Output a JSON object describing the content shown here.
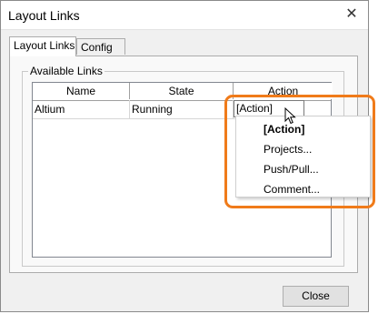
{
  "window": {
    "title": "Layout Links",
    "close_glyph": "✕"
  },
  "tabs": [
    {
      "label": "Layout Links",
      "active": true
    },
    {
      "label": "Config",
      "active": false
    }
  ],
  "group": {
    "legend": "Available Links"
  },
  "table": {
    "columns": [
      "Name",
      "State",
      "Action"
    ],
    "rows": [
      {
        "name": "Altium",
        "state": "Running",
        "action": "[Action]"
      }
    ]
  },
  "context_menu": {
    "items": [
      {
        "label": "[Action]",
        "bold": true
      },
      {
        "label": "Projects...",
        "bold": false
      },
      {
        "label": "Push/Pull...",
        "bold": false
      },
      {
        "label": "Comment...",
        "bold": false
      }
    ]
  },
  "footer": {
    "close_label": "Close"
  },
  "colors": {
    "highlight": "#f07b1a"
  },
  "icons": {
    "cursor": "mouse-pointer-icon",
    "close": "close-icon"
  }
}
